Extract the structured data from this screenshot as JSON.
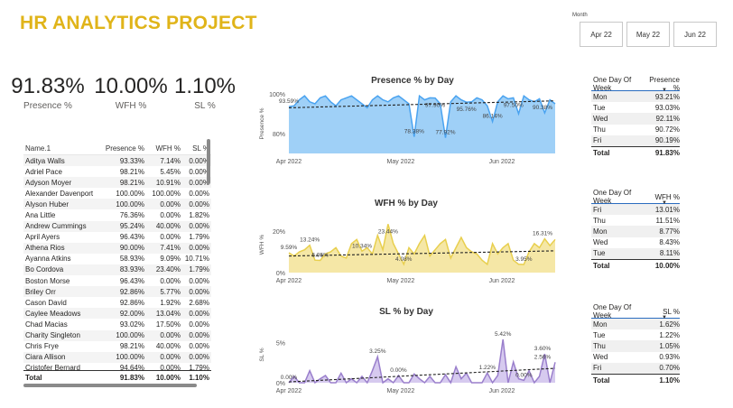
{
  "header": {
    "title": "HR ANALYTICS PROJECT"
  },
  "month_slicer": {
    "label": "Month",
    "options": [
      "Apr 22",
      "May 22",
      "Jun 22"
    ]
  },
  "kpis": [
    {
      "value": "91.83%",
      "label": "Presence %"
    },
    {
      "value": "10.00%",
      "label": "WFH %"
    },
    {
      "value": "1.10%",
      "label": "SL %"
    }
  ],
  "employee_table": {
    "headers": [
      "Name.1",
      "Presence %",
      "WFH %",
      "SL %"
    ],
    "rows": [
      [
        "Aditya Walls",
        "93.33%",
        "7.14%",
        "0.00%"
      ],
      [
        "Adriel Pace",
        "98.21%",
        "5.45%",
        "0.00%"
      ],
      [
        "Adyson Moyer",
        "98.21%",
        "10.91%",
        "0.00%"
      ],
      [
        "Alexander Davenport",
        "100.00%",
        "100.00%",
        "0.00%"
      ],
      [
        "Alyson Huber",
        "100.00%",
        "0.00%",
        "0.00%"
      ],
      [
        "Ana Little",
        "76.36%",
        "0.00%",
        "1.82%"
      ],
      [
        "Andrew Cummings",
        "95.24%",
        "40.00%",
        "0.00%"
      ],
      [
        "April Ayers",
        "96.43%",
        "0.00%",
        "1.79%"
      ],
      [
        "Athena Rios",
        "90.00%",
        "7.41%",
        "0.00%"
      ],
      [
        "Ayanna Atkins",
        "58.93%",
        "9.09%",
        "10.71%"
      ],
      [
        "Bo Cordova",
        "83.93%",
        "23.40%",
        "1.79%"
      ],
      [
        "Boston Morse",
        "96.43%",
        "0.00%",
        "0.00%"
      ],
      [
        "Briley Orr",
        "92.86%",
        "5.77%",
        "0.00%"
      ],
      [
        "Cason David",
        "92.86%",
        "1.92%",
        "2.68%"
      ],
      [
        "Caylee Meadows",
        "92.00%",
        "13.04%",
        "0.00%"
      ],
      [
        "Chad Macias",
        "93.02%",
        "17.50%",
        "0.00%"
      ],
      [
        "Charity Singleton",
        "100.00%",
        "0.00%",
        "0.00%"
      ],
      [
        "Chris Frye",
        "98.21%",
        "40.00%",
        "0.00%"
      ],
      [
        "Ciara Allison",
        "100.00%",
        "0.00%",
        "0.00%"
      ],
      [
        "Cristofer Bernard",
        "94.64%",
        "0.00%",
        "1.79%"
      ]
    ],
    "total": [
      "Total",
      "91.83%",
      "10.00%",
      "1.10%"
    ]
  },
  "chart_data": [
    {
      "type": "area",
      "title": "Presence % by Day",
      "ylabel": "Presence %",
      "y_ticks": [
        "100%",
        "80%"
      ],
      "x_ticks": [
        "Apr 2022",
        "May 2022",
        "Jun 2022"
      ],
      "ylim": [
        70,
        100
      ],
      "color": "#4aa3f0",
      "fill": "#9fd0f7",
      "values": [
        93.6,
        94,
        97,
        99,
        96,
        95,
        98,
        99,
        96,
        94,
        97,
        98,
        99,
        97,
        95,
        93,
        97,
        99,
        97,
        96,
        98,
        99,
        97,
        95,
        78.4,
        99,
        97,
        98,
        97.9,
        95,
        77.9,
        96,
        99,
        97,
        95.8,
        96,
        98,
        97,
        94,
        86.1,
        96,
        99,
        97.5,
        98,
        90,
        99,
        97,
        96,
        97.5,
        90.4,
        97,
        95
      ],
      "trend": [
        93.0,
        96.5
      ],
      "labels": [
        {
          "text": "93.59%",
          "i": 0
        },
        {
          "text": "78.38%",
          "i": 24
        },
        {
          "text": "97.90%",
          "i": 28
        },
        {
          "text": "77.92%",
          "i": 30
        },
        {
          "text": "95.76%",
          "i": 34
        },
        {
          "text": "86.14%",
          "i": 39
        },
        {
          "text": "97.50%",
          "i": 43
        },
        {
          "text": "90.38%",
          "i": 49
        }
      ]
    },
    {
      "type": "area",
      "title": "WFH % by Day",
      "ylabel": "WFH %",
      "y_ticks": [
        "20%",
        "0%"
      ],
      "x_ticks": [
        "Apr 2022",
        "May 2022",
        "Jun 2022"
      ],
      "ylim": [
        0,
        27
      ],
      "color": "#e8cf4e",
      "fill": "#f5e7a6",
      "values": [
        9.6,
        8,
        10,
        11,
        13.2,
        6,
        5.9,
        9,
        10,
        12,
        8,
        7,
        14,
        16,
        10.3,
        12,
        9,
        18,
        11,
        23.4,
        14,
        9,
        4,
        12,
        9,
        14,
        18,
        8,
        11,
        14,
        16,
        7,
        12,
        17,
        12,
        10,
        9,
        6,
        4,
        14,
        9,
        12,
        14,
        6,
        4,
        3.9,
        10,
        14,
        12,
        16.3,
        13,
        16
      ],
      "trend": [
        8.0,
        10.5
      ],
      "labels": [
        {
          "text": "9.59%",
          "i": 0
        },
        {
          "text": "13.24%",
          "i": 4
        },
        {
          "text": "5.95%",
          "i": 6
        },
        {
          "text": "10.34%",
          "i": 14
        },
        {
          "text": "23.44%",
          "i": 19
        },
        {
          "text": "4.08%",
          "i": 22
        },
        {
          "text": "3.95%",
          "i": 45
        },
        {
          "text": "16.31%",
          "i": 49
        }
      ]
    },
    {
      "type": "area",
      "title": "SL % by Day",
      "ylabel": "SL %",
      "y_ticks": [
        "5%",
        "0%"
      ],
      "x_ticks": [
        "Apr 2022",
        "May 2022",
        "Jun 2022"
      ],
      "ylim": [
        0,
        7
      ],
      "color": "#9a7fcc",
      "fill": "#d6caef",
      "values": [
        0,
        0.8,
        0,
        0,
        1.5,
        0,
        0.5,
        0.9,
        0,
        0,
        1.2,
        0,
        0.5,
        0,
        0.8,
        0,
        1.5,
        3.25,
        0,
        0.5,
        0,
        0.9,
        0,
        0,
        1.1,
        0.5,
        0,
        0.8,
        0,
        0,
        1.0,
        0,
        2.0,
        0.5,
        1.2,
        0,
        0,
        0,
        1.22,
        0,
        0.9,
        5.42,
        0,
        2.6,
        0.5,
        0.3,
        1.5,
        0,
        0.8,
        3.6,
        0,
        2.56
      ],
      "trend": [
        0.1,
        1.8
      ],
      "labels": [
        {
          "text": "0.00%",
          "i": 0
        },
        {
          "text": "3.25%",
          "i": 17
        },
        {
          "text": "0.00%",
          "i": 21
        },
        {
          "text": "1.22%",
          "i": 38
        },
        {
          "text": "5.42%",
          "i": 41
        },
        {
          "text": "0.00%",
          "i": 45
        },
        {
          "text": "3.60%",
          "i": 49
        },
        {
          "text": "2.56%",
          "i": 51
        }
      ]
    }
  ],
  "presence_by_weekday": {
    "headers": [
      "One Day Of Week",
      "Presence %"
    ],
    "rows": [
      [
        "Mon",
        "93.21%"
      ],
      [
        "Tue",
        "93.03%"
      ],
      [
        "Wed",
        "92.11%"
      ],
      [
        "Thu",
        "90.72%"
      ],
      [
        "Fri",
        "90.19%"
      ]
    ],
    "total": [
      "Total",
      "91.83%"
    ]
  },
  "wfh_by_weekday": {
    "headers": [
      "One Day Of Week",
      "WFH %"
    ],
    "rows": [
      [
        "Fri",
        "13.01%"
      ],
      [
        "Thu",
        "11.51%"
      ],
      [
        "Mon",
        "8.77%"
      ],
      [
        "Wed",
        "8.43%"
      ],
      [
        "Tue",
        "8.11%"
      ]
    ],
    "total": [
      "Total",
      "10.00%"
    ]
  },
  "sl_by_weekday": {
    "headers": [
      "One Day Of Week",
      "SL %"
    ],
    "rows": [
      [
        "Mon",
        "1.62%"
      ],
      [
        "Tue",
        "1.22%"
      ],
      [
        "Thu",
        "1.05%"
      ],
      [
        "Wed",
        "0.93%"
      ],
      [
        "Fri",
        "0.70%"
      ]
    ],
    "total": [
      "Total",
      "1.10%"
    ]
  }
}
